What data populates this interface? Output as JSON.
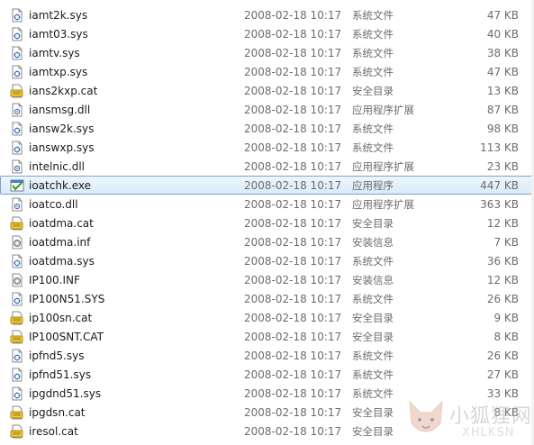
{
  "files": [
    {
      "name": "iamt2k.sys",
      "date": "2008-02-18 10:17",
      "type": "系统文件",
      "size": "47 KB",
      "icon": "sys-file-icon"
    },
    {
      "name": "iamt03.sys",
      "date": "2008-02-18 10:17",
      "type": "系统文件",
      "size": "40 KB",
      "icon": "sys-file-icon"
    },
    {
      "name": "iamtv.sys",
      "date": "2008-02-18 10:17",
      "type": "系统文件",
      "size": "38 KB",
      "icon": "sys-file-icon"
    },
    {
      "name": "iamtxp.sys",
      "date": "2008-02-18 10:17",
      "type": "系统文件",
      "size": "47 KB",
      "icon": "sys-file-icon"
    },
    {
      "name": "ians2kxp.cat",
      "date": "2008-02-18 10:17",
      "type": "安全目录",
      "size": "13 KB",
      "icon": "cat-file-icon"
    },
    {
      "name": "iansmsg.dll",
      "date": "2008-02-18 10:17",
      "type": "应用程序扩展",
      "size": "87 KB",
      "icon": "dll-file-icon"
    },
    {
      "name": "iansw2k.sys",
      "date": "2008-02-18 10:17",
      "type": "系统文件",
      "size": "98 KB",
      "icon": "sys-file-icon"
    },
    {
      "name": "ianswxp.sys",
      "date": "2008-02-18 10:17",
      "type": "系统文件",
      "size": "113 KB",
      "icon": "sys-file-icon"
    },
    {
      "name": "intelnic.dll",
      "date": "2008-02-18 10:17",
      "type": "应用程序扩展",
      "size": "23 KB",
      "icon": "dll-file-icon"
    },
    {
      "name": "ioatchk.exe",
      "date": "2008-02-18 10:17",
      "type": "应用程序",
      "size": "447 KB",
      "icon": "exe-file-icon",
      "selected": true
    },
    {
      "name": "ioatco.dll",
      "date": "2008-02-18 10:17",
      "type": "应用程序扩展",
      "size": "363 KB",
      "icon": "dll-file-icon"
    },
    {
      "name": "ioatdma.cat",
      "date": "2008-02-18 10:17",
      "type": "安全目录",
      "size": "12 KB",
      "icon": "cat-file-icon"
    },
    {
      "name": "ioatdma.inf",
      "date": "2008-02-18 10:17",
      "type": "安装信息",
      "size": "7 KB",
      "icon": "inf-file-icon"
    },
    {
      "name": "ioatdma.sys",
      "date": "2008-02-18 10:17",
      "type": "系统文件",
      "size": "36 KB",
      "icon": "sys-file-icon"
    },
    {
      "name": "IP100.INF",
      "date": "2008-02-18 10:17",
      "type": "安装信息",
      "size": "12 KB",
      "icon": "inf-file-icon"
    },
    {
      "name": "IP100N51.SYS",
      "date": "2008-02-18 10:17",
      "type": "系统文件",
      "size": "26 KB",
      "icon": "sys-file-icon"
    },
    {
      "name": "ip100sn.cat",
      "date": "2008-02-18 10:17",
      "type": "安全目录",
      "size": "9 KB",
      "icon": "cat-file-icon"
    },
    {
      "name": "IP100SNT.CAT",
      "date": "2008-02-18 10:17",
      "type": "安全目录",
      "size": "8 KB",
      "icon": "cat-file-icon"
    },
    {
      "name": "ipfnd5.sys",
      "date": "2008-02-18 10:17",
      "type": "系统文件",
      "size": "26 KB",
      "icon": "sys-file-icon"
    },
    {
      "name": "ipfnd51.sys",
      "date": "2008-02-18 10:17",
      "type": "系统文件",
      "size": "27 KB",
      "icon": "sys-file-icon"
    },
    {
      "name": "ipgdnd51.sys",
      "date": "2008-02-18 10:17",
      "type": "系统文件",
      "size": "33 KB",
      "icon": "sys-file-icon"
    },
    {
      "name": "ipgdsn.cat",
      "date": "2008-02-18 10:17",
      "type": "安全目录",
      "size": "8 KB",
      "icon": "cat-file-icon"
    },
    {
      "name": "iresol.cat",
      "date": "2008-02-18 10:17",
      "type": "安全目录",
      "size": "",
      "icon": "cat-file-icon"
    }
  ],
  "watermark": {
    "cn": "小狐狸网",
    "en": "XHLKSN"
  }
}
